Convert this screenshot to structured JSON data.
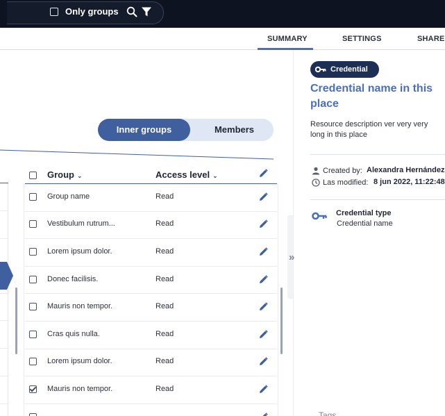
{
  "topbar": {
    "only_groups_label": "Only groups",
    "search_icon": "search-icon",
    "filter_icon": "filter-icon"
  },
  "tabs": [
    {
      "label": "SUMMARY",
      "active": true
    },
    {
      "label": "SETTINGS",
      "active": false
    },
    {
      "label": "SHARE",
      "active": false
    }
  ],
  "toggle": {
    "inner_groups": "Inner groups",
    "members": "Members",
    "active": "Inner groups"
  },
  "table": {
    "headers": {
      "group": "Group",
      "access": "Access level"
    },
    "rows": [
      {
        "name": "Group name",
        "access": "Read",
        "checked": false
      },
      {
        "name": "Vestibulum rutrum...",
        "access": "Read",
        "checked": false
      },
      {
        "name": "Lorem ipsum dolor.",
        "access": "Read",
        "checked": false
      },
      {
        "name": "Donec facilisis.",
        "access": "Read",
        "checked": false
      },
      {
        "name": "Mauris non tempor.",
        "access": "Read",
        "checked": false
      },
      {
        "name": "Cras quis nulla.",
        "access": "Read",
        "checked": false
      },
      {
        "name": "Lorem ipsum dolor.",
        "access": "Read",
        "checked": false
      },
      {
        "name": "Mauris non tempor.",
        "access": "Read",
        "checked": true
      }
    ]
  },
  "summary": {
    "badge": "Credential",
    "title": "Credential name in this place",
    "description": "Resource description ver very very long in this place",
    "created_by_label": "Created by:",
    "created_by_value": "Alexandra Hernández",
    "modified_label": "Las modified:",
    "modified_value": "8 jun 2022, 11:22:48",
    "credential_type_label": "Credential type",
    "credential_type_value": "Credential name",
    "tags_label": "Tags"
  },
  "colors": {
    "primary": "#3f5f9e",
    "accent": "#4a6fbf",
    "topbar": "#0d1320",
    "badge": "#1d2f55"
  }
}
